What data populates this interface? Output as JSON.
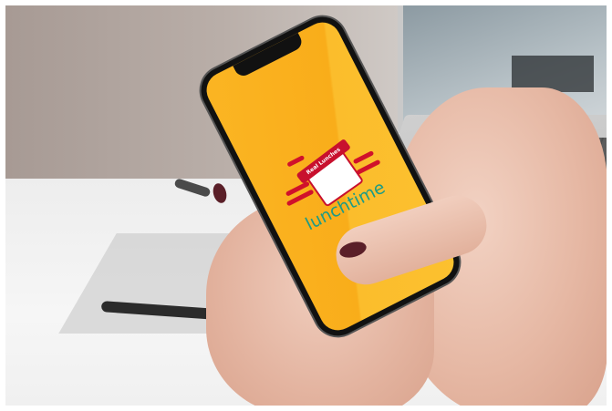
{
  "app": {
    "brand_name": "lunchtime",
    "badge_text": "Real Lunches",
    "colors": {
      "screen_background": "#f9ad1a",
      "brand_text": "#1d9b86",
      "logo_red": "#c8102e"
    }
  }
}
